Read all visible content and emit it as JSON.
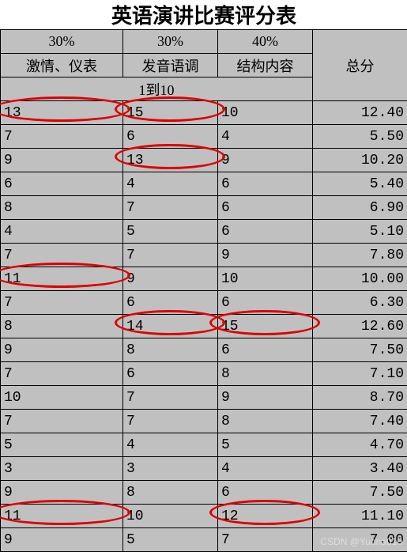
{
  "title": "英语演讲比赛评分表",
  "weights": {
    "w1": "30%",
    "w2": "30%",
    "w3": "40%"
  },
  "headers": {
    "h1": "激情、仪表",
    "h2": "发音语调",
    "h3": "结构内容",
    "total": "总分"
  },
  "range_label": "1到10",
  "rows": [
    {
      "c1": "13",
      "c2": "15",
      "c3": "10",
      "c4": "12.40"
    },
    {
      "c1": "7",
      "c2": "6",
      "c3": "4",
      "c4": "5.50"
    },
    {
      "c1": "9",
      "c2": "13",
      "c3": "9",
      "c4": "10.20"
    },
    {
      "c1": "6",
      "c2": "4",
      "c3": "6",
      "c4": "5.40"
    },
    {
      "c1": "8",
      "c2": "7",
      "c3": "6",
      "c4": "6.90"
    },
    {
      "c1": "4",
      "c2": "5",
      "c3": "6",
      "c4": "5.10"
    },
    {
      "c1": "7",
      "c2": "7",
      "c3": "9",
      "c4": "7.80"
    },
    {
      "c1": "11",
      "c2": "9",
      "c3": "10",
      "c4": "10.00"
    },
    {
      "c1": "7",
      "c2": "6",
      "c3": "6",
      "c4": "6.30"
    },
    {
      "c1": "8",
      "c2": "14",
      "c3": "15",
      "c4": "12.60"
    },
    {
      "c1": "9",
      "c2": "8",
      "c3": "6",
      "c4": "7.50"
    },
    {
      "c1": "7",
      "c2": "6",
      "c3": "8",
      "c4": "7.10"
    },
    {
      "c1": "10",
      "c2": "7",
      "c3": "9",
      "c4": "8.70"
    },
    {
      "c1": "7",
      "c2": "7",
      "c3": "8",
      "c4": "7.40"
    },
    {
      "c1": "5",
      "c2": "4",
      "c3": "5",
      "c4": "4.70"
    },
    {
      "c1": "3",
      "c2": "3",
      "c3": "4",
      "c4": "3.40"
    },
    {
      "c1": "9",
      "c2": "8",
      "c3": "6",
      "c4": "7.50"
    },
    {
      "c1": "11",
      "c2": "10",
      "c3": "12",
      "c4": "11.10"
    },
    {
      "c1": "9",
      "c2": "5",
      "c3": "7",
      "c4": "7.00"
    }
  ],
  "watermark": "CSDN @Yuana010",
  "circles": [
    {
      "row": 0,
      "col": 0
    },
    {
      "row": 0,
      "col": 1
    },
    {
      "row": 2,
      "col": 1
    },
    {
      "row": 7,
      "col": 0
    },
    {
      "row": 9,
      "col": 1
    },
    {
      "row": 9,
      "col": 2
    },
    {
      "row": 17,
      "col": 0
    },
    {
      "row": 17,
      "col": 2
    }
  ],
  "chart_data": {
    "type": "table",
    "title": "英语演讲比赛评分表",
    "columns": [
      "激情、仪表 (30%)",
      "发音语调 (30%)",
      "结构内容 (40%)",
      "总分"
    ],
    "value_range": "1到10",
    "rows": [
      [
        13,
        15,
        10,
        12.4
      ],
      [
        7,
        6,
        4,
        5.5
      ],
      [
        9,
        13,
        9,
        10.2
      ],
      [
        6,
        4,
        6,
        5.4
      ],
      [
        8,
        7,
        6,
        6.9
      ],
      [
        4,
        5,
        6,
        5.1
      ],
      [
        7,
        7,
        9,
        7.8
      ],
      [
        11,
        9,
        10,
        10.0
      ],
      [
        7,
        6,
        6,
        6.3
      ],
      [
        8,
        14,
        15,
        12.6
      ],
      [
        9,
        8,
        6,
        7.5
      ],
      [
        7,
        6,
        8,
        7.1
      ],
      [
        10,
        7,
        9,
        8.7
      ],
      [
        7,
        7,
        8,
        7.4
      ],
      [
        5,
        4,
        5,
        4.7
      ],
      [
        3,
        3,
        4,
        3.4
      ],
      [
        9,
        8,
        6,
        7.5
      ],
      [
        11,
        10,
        12,
        11.1
      ],
      [
        9,
        5,
        7,
        7.0
      ]
    ],
    "highlighted_cells_out_of_range": [
      [
        0,
        0
      ],
      [
        0,
        1
      ],
      [
        2,
        1
      ],
      [
        7,
        0
      ],
      [
        9,
        1
      ],
      [
        9,
        2
      ],
      [
        17,
        0
      ],
      [
        17,
        2
      ]
    ]
  }
}
